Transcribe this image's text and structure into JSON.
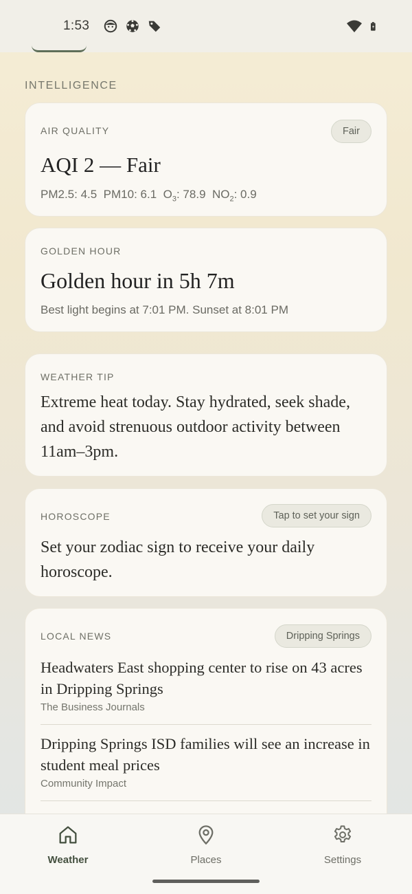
{
  "status_bar": {
    "time": "1:53",
    "icons": [
      "face-icon",
      "soccer-ball-icon",
      "tag-icon"
    ],
    "right_icons": [
      "wifi-icon",
      "battery-icon"
    ]
  },
  "section": {
    "title": "INTELLIGENCE"
  },
  "air_quality": {
    "label": "AIR QUALITY",
    "badge": "Fair",
    "headline": "AQI 2 — Fair",
    "pm25": "PM2.5: 4.5",
    "pm10": "PM10: 6.1",
    "o3_prefix": "O",
    "o3_sub": "3",
    "o3_value": ": 78.9",
    "no2_prefix": "NO",
    "no2_sub": "2",
    "no2_value": ": 0.9"
  },
  "golden_hour": {
    "label": "GOLDEN HOUR",
    "headline": "Golden hour in 5h 7m",
    "subtitle": "Best light begins at 7:01 PM. Sunset at 8:01 PM"
  },
  "weather_tip": {
    "label": "WEATHER TIP",
    "text": "Extreme heat today. Stay hydrated, seek shade, and avoid strenuous outdoor activity between 11am–3pm."
  },
  "horoscope": {
    "label": "HOROSCOPE",
    "button": "Tap to set your sign",
    "text": "Set your zodiac sign to receive your daily horoscope."
  },
  "local_news": {
    "label": "LOCAL NEWS",
    "location": "Dripping Springs",
    "items": [
      {
        "title": "Headwaters East shopping center to rise on 43 acres in Dripping Springs",
        "source": "The Business Journals"
      },
      {
        "title": "Dripping Springs ISD families will see an increase in student meal prices",
        "source": "Community Impact"
      }
    ]
  },
  "bottom_nav": {
    "items": [
      {
        "label": "Weather",
        "icon": "home-icon",
        "active": true
      },
      {
        "label": "Places",
        "icon": "location-pin-icon",
        "active": false
      },
      {
        "label": "Settings",
        "icon": "gear-icon",
        "active": false
      }
    ]
  },
  "colors": {
    "accent": "#44503f",
    "card_bg": "#faf8f3",
    "pill_bg": "#eae9e0"
  }
}
